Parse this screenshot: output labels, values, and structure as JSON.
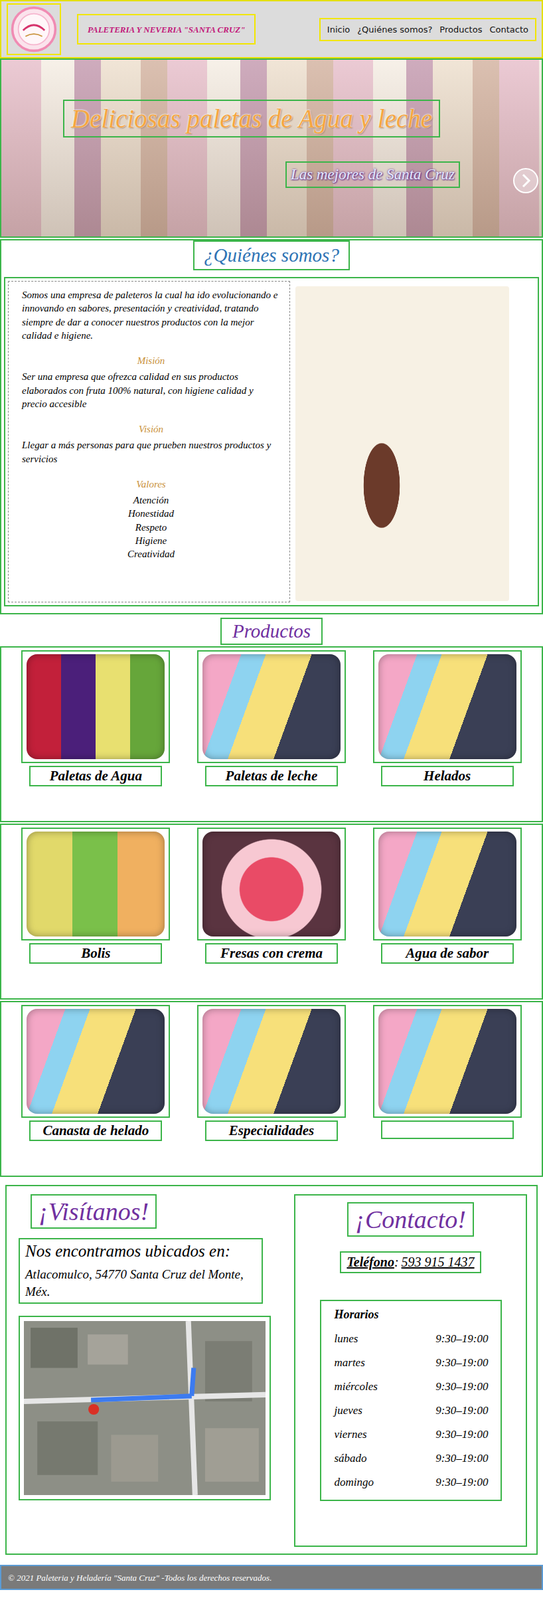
{
  "header": {
    "title": "PALETERIA Y NEVERIA \"SANTA CRUZ\"",
    "nav": [
      {
        "label": "Inicio"
      },
      {
        "label": "¿Quiénes somos?"
      },
      {
        "label": "Productos"
      },
      {
        "label": "Contacto"
      }
    ]
  },
  "hero": {
    "title": "Deliciosas paletas de Agua y leche",
    "subtitle": "Las mejores de Santa Cruz"
  },
  "about": {
    "title": "¿Quiénes somos?",
    "intro": "Somos una empresa de paleteros la cual ha ido evolucionando e innovando en sabores, presentación y creatividad, tratando siempre de dar a conocer nuestros productos con la mejor calidad e higiene.",
    "mission_title": "Misión",
    "mission": "Ser una empresa que ofrezca calidad en sus productos elaborados con fruta 100% natural, con higiene calidad y precio accesible",
    "vision_title": "Visión",
    "vision": "Llegar a más personas para que prueben nuestros productos y servicios",
    "values_title": "Valores",
    "values": [
      "Atención",
      "Honestidad",
      "Respeto",
      "Higiene",
      "Creatividad"
    ]
  },
  "products": {
    "title": "Productos",
    "rows": [
      [
        "Paletas de Agua",
        "Paletas de leche",
        "Helados"
      ],
      [
        "Bolis",
        "Fresas con crema",
        "Agua de sabor"
      ],
      [
        "Canasta de helado",
        "Especialidades",
        ""
      ]
    ]
  },
  "visit": {
    "title": "¡Visítanos!",
    "subtitle": "Nos encontramos ubicados en:",
    "address": "Atlacomulco, 54770 Santa Cruz del Monte, Méx."
  },
  "contact": {
    "title": "¡Contacto!",
    "phone_label": "Teléfono",
    "separator": ":",
    "phone": "593 915 1437",
    "hours_title": "Horarios",
    "hours": [
      {
        "day": "lunes",
        "time": "9:30–19:00"
      },
      {
        "day": "martes",
        "time": "9:30–19:00"
      },
      {
        "day": "miércoles",
        "time": "9:30–19:00"
      },
      {
        "day": "jueves",
        "time": "9:30–19:00"
      },
      {
        "day": "viernes",
        "time": "9:30–19:00"
      },
      {
        "day": "sábado",
        "time": "9:30–19:00"
      },
      {
        "day": "domingo",
        "time": "9:30–19:00"
      }
    ]
  },
  "footer": "© 2021 Paleteria y Heladería \"Santa Cruz\" -Todos los derechos reservados."
}
